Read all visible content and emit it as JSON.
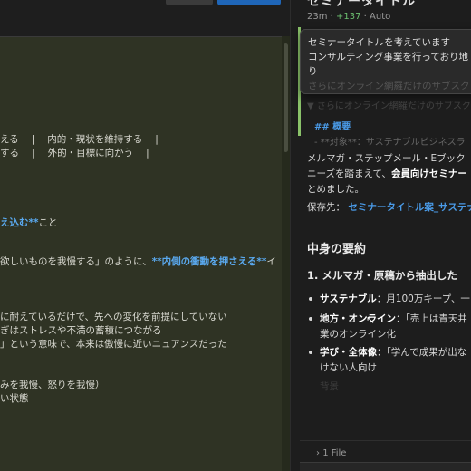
{
  "editor": {
    "lines": [
      {
        "parts": [
          {
            "t": "える  |  内的・現状を維持する  |"
          }
        ]
      },
      {
        "parts": [
          {
            "t": "する  |  外的・目標に向かう  |"
          }
        ]
      },
      {
        "parts": [
          {
            "t": "え込む**",
            "md": true
          },
          {
            "t": "こと"
          }
        ]
      },
      {
        "parts": [
          {
            "t": "欲しいものを我慢する」のように、"
          },
          {
            "t": "**内側の衝動を押さえる**",
            "md": true
          },
          {
            "t": "イ"
          }
        ]
      },
      {
        "parts": [
          {
            "t": "に耐えているだけで、先への変化を前提にしていない"
          }
        ]
      },
      {
        "parts": [
          {
            "t": "ぎはストレスや不満の蓄積につながる"
          }
        ]
      },
      {
        "parts": [
          {
            "t": "」という意味で、本来は傲慢に近いニュアンスだった"
          }
        ]
      },
      {
        "parts": [
          {
            "t": "みを我慢、怒りを我慢）"
          }
        ]
      },
      {
        "parts": [
          {
            "t": "い状態"
          }
        ]
      }
    ]
  },
  "chat": {
    "top_title": "セミナータイトル",
    "meta": {
      "time": "23m",
      "diff": "+137",
      "mode": "Auto"
    },
    "popover": {
      "line1": "セミナータイトルを考えています",
      "line2": "コンサルティング事業を行っており地",
      "line3": "り",
      "line4": "さらにオンライン網羅だけのサブスク"
    },
    "snippet": {
      "heading": "## 概要",
      "item": "- **対象**：サステナブルビジネスラ"
    },
    "intro": {
      "l1a": "メルマガ・ステップメール・Eブック",
      "l2a": "ニーズを踏まえて、",
      "l2b": "会員向けセミナー",
      "l3": "とめました。"
    },
    "save": {
      "label": "保存先：",
      "link": "セミナータイトル案_サステナ"
    },
    "section_title": "中身の要約",
    "subsection_title": "1. メルマガ・原稿から抽出した",
    "bullets": [
      {
        "key": "サステナブル",
        "text": "：月100万キープ、一"
      },
      {
        "key": "地方・オンライン",
        "text": "：「売上は青天井",
        "cont": "業のオンライン化"
      },
      {
        "key": "学び・全体像",
        "text": "：「学んで成果が出な",
        "cont": "けない人向け"
      }
    ],
    "faded_next": "背景",
    "files_label": "1 File"
  }
}
